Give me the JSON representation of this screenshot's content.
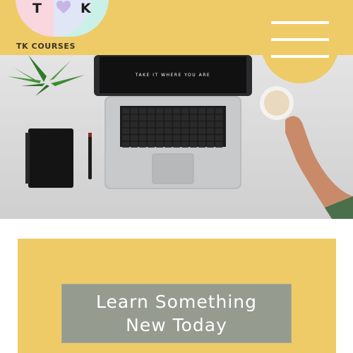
{
  "header": {
    "logo": {
      "letter_left": "T",
      "letter_right": "K",
      "name": "TK COURSES"
    },
    "menu_icon": "hamburger-menu-icon"
  },
  "hero": {
    "screen_text": "TAKE IT WHERE YOU ARE",
    "icons": [
      "laptop",
      "notebook",
      "pen",
      "coffee-cup",
      "plant"
    ]
  },
  "cta": {
    "label": "Learn Something New Today"
  },
  "colors": {
    "brand_yellow": "#eecb67",
    "button_gray": "#959b8f",
    "logo_pink": "#f9d7df",
    "logo_mint": "#c9f1e7",
    "heart_lavender": "#c6b6e6"
  }
}
